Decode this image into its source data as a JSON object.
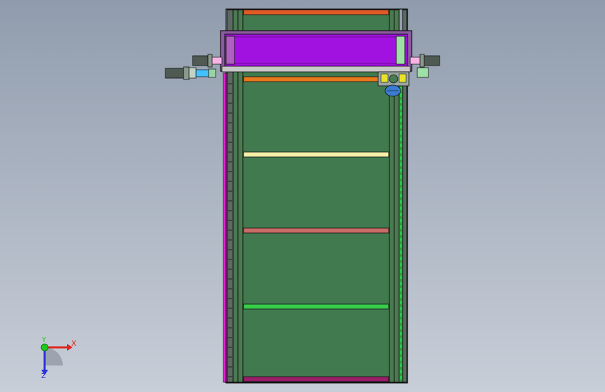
{
  "viewport": {
    "background_top": "#909cad",
    "background_bottom": "#c8ced8"
  },
  "model": {
    "frame_colors": {
      "outline": "#111111",
      "rail": "#4a7a50",
      "bed": "#417a4f",
      "left_strip": "#e023d0",
      "right_chain": "#22c94a"
    },
    "cross_bars": [
      {
        "name": "bar-top-orange",
        "color": "#e05a26"
      },
      {
        "name": "bar-orange-2",
        "color": "#e8781c"
      },
      {
        "name": "bar-cream",
        "color": "#f3f0a8"
      },
      {
        "name": "bar-salmon",
        "color": "#c96b67"
      },
      {
        "name": "bar-green",
        "color": "#37cc4a"
      },
      {
        "name": "bar-bottom-magenta",
        "color": "#9a1e6a"
      }
    ],
    "carriage": {
      "color": "#a112e0",
      "end_color": "#9ee0a8"
    },
    "motor_body_color": "#4e5a52",
    "motor_accent_color": "#f7b4e4",
    "motor_ring_color": "#43c0ff",
    "gearbox_color": "#3b7bd0",
    "gearbox_accent": "#e8e12a"
  },
  "triad": {
    "x_label": "X",
    "y_label": "Y",
    "z_label": "Z",
    "x_color": "#e0261f",
    "y_color": "#1fc81f",
    "z_color": "#2b33d9"
  }
}
